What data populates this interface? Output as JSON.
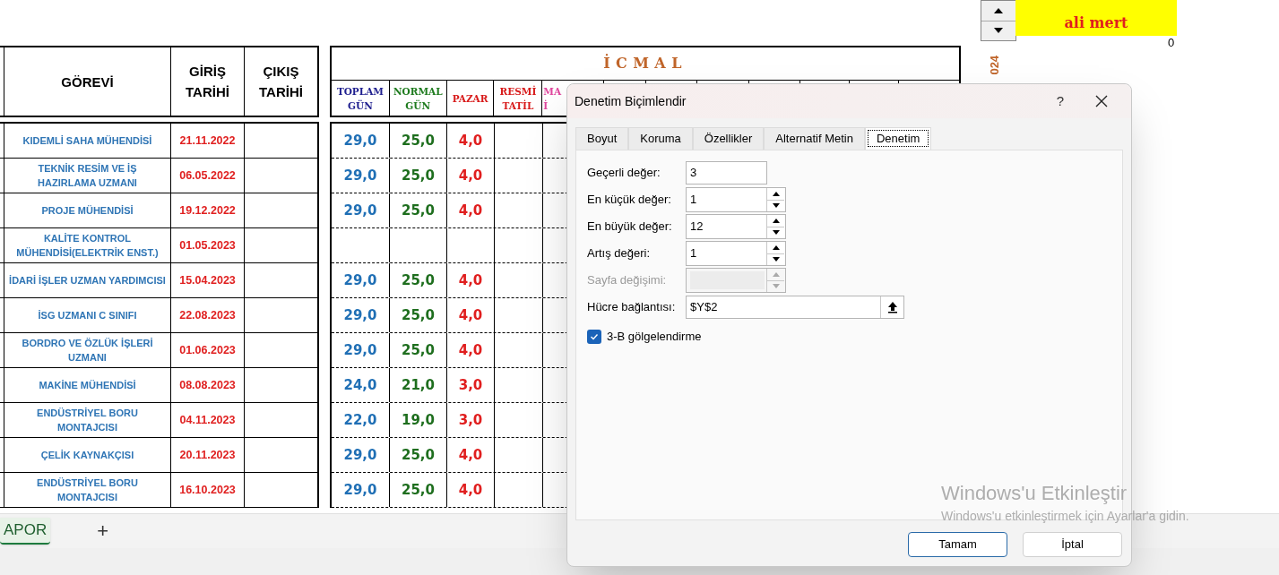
{
  "sheet": {
    "left_headers": [
      "GÖREVİ",
      "GİRİŞ TARİHİ",
      "ÇIKIŞ TARİHİ"
    ],
    "icmal": {
      "title": "İCMAL",
      "columns": [
        {
          "label": "TOPLAM GÜN",
          "color": "#1f1f8f"
        },
        {
          "label": "NORMAL GÜN",
          "color": "#1e7b1e"
        },
        {
          "label": "PAZAR",
          "color": "#d81b1b"
        },
        {
          "label": "RESMİ TATİL",
          "color": "#d81b1b"
        },
        {
          "label": "MA\nİ",
          "color": "#e0479e"
        }
      ]
    },
    "rows": [
      {
        "position": "KIDEMLİ SAHA MÜHENDİSİ",
        "start": "21.11.2022",
        "total": "29,0",
        "normal": "25,0",
        "sunday": "4,0"
      },
      {
        "position": "TEKNİK RESİM VE İŞ HAZIRLAMA UZMANI",
        "start": "06.05.2022",
        "total": "29,0",
        "normal": "25,0",
        "sunday": "4,0"
      },
      {
        "position": "PROJE MÜHENDİSİ",
        "start": "19.12.2022",
        "total": "29,0",
        "normal": "25,0",
        "sunday": "4,0"
      },
      {
        "position": "KALİTE KONTROL MÜHENDİSİ(ELEKTRİK ENST.)",
        "start": "01.05.2023"
      },
      {
        "position": "İDARİ İŞLER UZMAN YARDIMCISI",
        "start": "15.04.2023",
        "total": "29,0",
        "normal": "25,0",
        "sunday": "4,0"
      },
      {
        "position": "İSG UZMANI C SINIFI",
        "start": "22.08.2023",
        "total": "29,0",
        "normal": "25,0",
        "sunday": "4,0"
      },
      {
        "position": "BORDRO VE ÖZLÜK İŞLERİ UZMANI",
        "start": "01.06.2023",
        "total": "29,0",
        "normal": "25,0",
        "sunday": "4,0"
      },
      {
        "position": "MAKİNE MÜHENDİSİ",
        "start": "08.08.2023",
        "total": "24,0",
        "normal": "21,0",
        "sunday": "3,0"
      },
      {
        "position": "ENDÜSTRİYEL BORU MONTAJCISI",
        "start": "04.11.2023",
        "total": "22,0",
        "normal": "19,0",
        "sunday": "3,0"
      },
      {
        "position": "ÇELİK KAYNAKÇISI",
        "start": "20.11.2023",
        "total": "29,0",
        "normal": "25,0",
        "sunday": "4,0"
      },
      {
        "position": "ENDÜSTRİYEL BORU MONTAJCISI",
        "start": "16.10.2023",
        "total": "29,0",
        "normal": "25,0",
        "sunday": "4,0"
      }
    ],
    "name_box": "ali mert",
    "side_value": "0",
    "year_label": "024",
    "sheet_tabs": [
      {
        "label": "APOR",
        "selected": true
      }
    ],
    "add_sheet": "+"
  },
  "dialog": {
    "title": "Denetim Biçimlendir",
    "help": "?",
    "tabs": [
      {
        "label": "Boyut",
        "selected": false
      },
      {
        "label": "Koruma",
        "selected": false
      },
      {
        "label": "Özellikler",
        "selected": false
      },
      {
        "label": "Alternatif Metin",
        "selected": false
      },
      {
        "label": "Denetim",
        "selected": true
      }
    ],
    "fields": [
      {
        "label": "Geçerli değer:",
        "kind": "text",
        "value": "3",
        "disabled": false
      },
      {
        "label": "En küçük değer:",
        "kind": "spin",
        "value": "1",
        "disabled": false
      },
      {
        "label": "En büyük değer:",
        "kind": "spin",
        "value": "12",
        "disabled": false
      },
      {
        "label": "Artış değeri:",
        "kind": "spin",
        "value": "1",
        "disabled": false
      },
      {
        "label": "Sayfa değişimi:",
        "kind": "spin",
        "disabled": true
      },
      {
        "label": "Hücre bağlantısı:",
        "kind": "ref",
        "value": "$Y$2",
        "disabled": false
      }
    ],
    "checkbox": {
      "label": "3-B gölgelendirme",
      "checked": true
    },
    "buttons": [
      "Tamam",
      "İptal"
    ]
  },
  "activation": {
    "title": "Windows'u Etkinleştir",
    "message": "Windows'u etkinleştirmek için Ayarlar'a gidin."
  }
}
